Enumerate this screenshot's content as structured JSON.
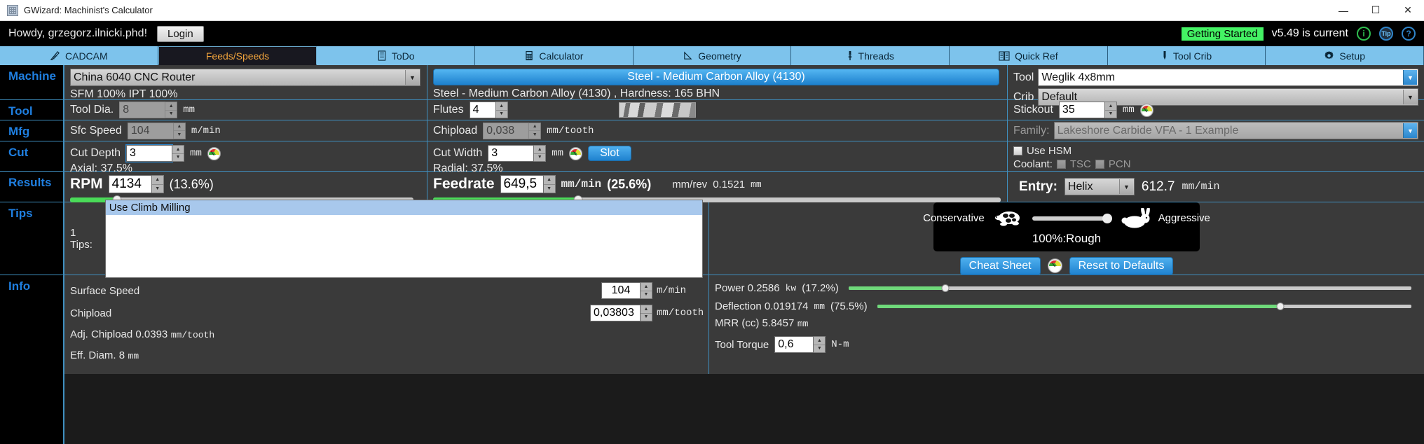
{
  "window": {
    "title": "GWizard: Machinist's Calculator",
    "icon": "grid-icon",
    "minimize": "—",
    "maximize": "☐",
    "close": "✕"
  },
  "account_bar": {
    "greeting": "Howdy, grzegorz.ilnicki.phd!",
    "login_label": "Login",
    "getting_started": "Getting Started",
    "version": "v5.49 is current",
    "icons": [
      "info-icon",
      "tip-icon",
      "help-icon"
    ],
    "tip_icon_label": "Tip",
    "help_icon_label": "?",
    "info_icon_label": "i",
    "accent_green": "#44f264"
  },
  "tabs": [
    {
      "label": "CADCAM",
      "icon": "cadcam-icon",
      "active": false
    },
    {
      "label": "Feeds/Speeds",
      "icon": "none",
      "active": true
    },
    {
      "label": "ToDo",
      "icon": "todo-list-icon",
      "active": false
    },
    {
      "label": "Calculator",
      "icon": "calculator-icon",
      "active": false
    },
    {
      "label": "Geometry",
      "icon": "geometry-icon",
      "active": false
    },
    {
      "label": "Threads",
      "icon": "thread-tap-icon",
      "active": false
    },
    {
      "label": "Quick Ref",
      "icon": "book-icon",
      "active": false
    },
    {
      "label": "Tool Crib",
      "icon": "endmill-icon",
      "active": false
    },
    {
      "label": "Setup",
      "icon": "gear-icon",
      "active": false
    }
  ],
  "rail": [
    {
      "label": "Machine"
    },
    {
      "label": "Tool"
    },
    {
      "label": "Mfg"
    },
    {
      "label": "Cut"
    },
    {
      "label": "Results"
    },
    {
      "label": "Tips"
    },
    {
      "label": "Info"
    }
  ],
  "machine": {
    "machine_select": "China 6040 CNC Router",
    "overrides": "SFM 100% IPT 100%",
    "material_banner": "Steel - Medium Carbon Alloy (4130)",
    "material_detail": "Steel - Medium Carbon Alloy (4130) , Hardness: 165 BHN",
    "tool_label": "Tool",
    "tool_value": "Weglik 4x8mm",
    "crib_label": "Crib",
    "crib_value": "Default"
  },
  "tool": {
    "dia_label": "Tool Dia.",
    "dia_value": "8",
    "dia_unit": "mm",
    "flutes_label": "Flutes",
    "flutes_value": "4",
    "endmill_image": "endmill-photo",
    "stickout_label": "Stickout",
    "stickout_value": "35",
    "stickout_unit": "mm",
    "stickout_gauge": "gauge-icon"
  },
  "mfg": {
    "sfc_label": "Sfc Speed",
    "sfc_value": "104",
    "sfc_unit": "m/min",
    "chipload_label": "Chipload",
    "chipload_value": "0,038",
    "chipload_unit": "mm/tooth",
    "family_label": "Family:",
    "family_value": "Lakeshore Carbide VFA - 1 Example"
  },
  "cut": {
    "depth_label": "Cut Depth",
    "depth_value": "3",
    "depth_unit": "mm",
    "depth_gauge": "gauge-icon",
    "axial_text": "Axial: 37.5%",
    "width_label": "Cut Width",
    "width_value": "3",
    "width_unit": "mm",
    "width_gauge": "gauge-icon",
    "slot_label": "Slot",
    "radial_text": "Radial: 37.5%",
    "hsm_label": "Use HSM",
    "hsm_checked": false,
    "coolant_label": "Coolant:",
    "tsc_label": "TSC",
    "pcn_label": "PCN"
  },
  "results": {
    "rpm_label": "RPM",
    "rpm_value": "4134",
    "rpm_pct": "(13.6%)",
    "rpm_slider_pct": 13.6,
    "feed_label": "Feedrate",
    "feed_value": "649,5",
    "feed_unit": "mm/min",
    "feed_pct": "(25.6%)",
    "feed_slider_pct": 25.6,
    "mmrev_label": "mm/rev",
    "mmrev_value": "0.1521",
    "mmrev_unit": "mm",
    "entry_label": "Entry:",
    "entry_value": "Helix",
    "entry_rate": "612.7",
    "entry_unit": "mm/min"
  },
  "tips": {
    "count_label": "1 Tips:",
    "items": [
      "Use Climb Milling"
    ],
    "selected_index": 0
  },
  "aggressiveness": {
    "conservative_label": "Conservative",
    "aggressive_label": "Aggressive",
    "turtle_icon": "turtle-icon",
    "rabbit_icon": "rabbit-icon",
    "value_label": "100%:Rough",
    "slider_pct": 100,
    "cheat_sheet_label": "Cheat Sheet",
    "gauge_icon": "gauge-icon",
    "reset_label": "Reset to Defaults"
  },
  "info": {
    "surface_speed_label": "Surface Speed",
    "surface_speed_value": "104",
    "surface_speed_unit": "m/min",
    "chipload_label": "Chipload",
    "chipload_value": "0,03803",
    "chipload_unit": "mm/tooth",
    "adj_chipload": "Adj. Chipload 0.0393",
    "adj_chipload_unit": "mm/tooth",
    "eff_diam": "Eff. Diam. 8",
    "eff_diam_unit": "mm",
    "power_text": "Power 0.2586",
    "power_unit": "kw",
    "power_pct": "(17.2%)",
    "power_bar_pct": 17.2,
    "deflection_text": "Deflection 0.019174",
    "deflection_unit": "mm",
    "deflection_pct": "(75.5%)",
    "deflection_bar_pct": 75.5,
    "mrr_text": "MRR (cc) 5.8457",
    "mrr_unit": "mm",
    "torque_label": "Tool Torque",
    "torque_value": "0,6",
    "torque_unit": "N-m"
  }
}
